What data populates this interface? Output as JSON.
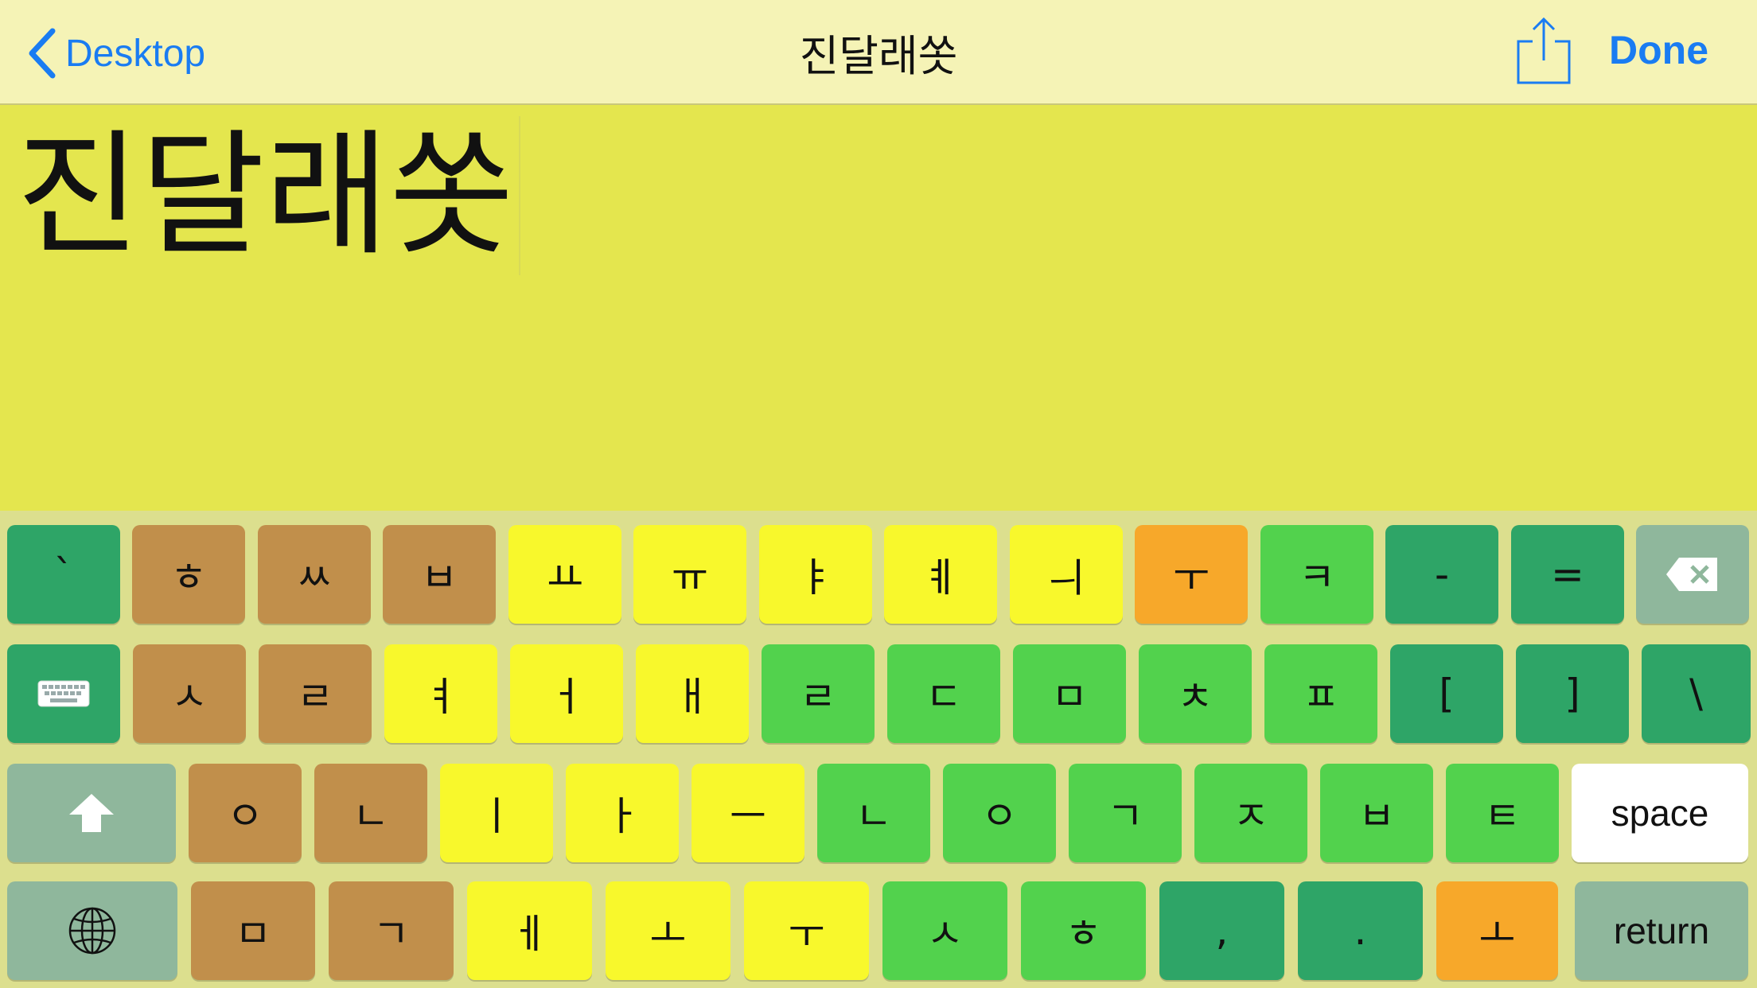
{
  "navbar": {
    "back_label": "Desktop",
    "title": "진달래쏫",
    "share_icon": "share-icon",
    "done_label": "Done"
  },
  "editor": {
    "text": "진달래쏫"
  },
  "colors": {
    "accent": "#1a7cf2",
    "background": "#e4e64e",
    "key_teal": "#2ea567",
    "key_brown": "#c18f4b",
    "key_yellow": "#f8f82c",
    "key_orange": "#f7a82a",
    "key_green": "#52d24d",
    "key_gray": "#8fb79c"
  },
  "keyboard": {
    "row1": [
      "`",
      "ㅎ",
      "ㅆ",
      "ㅂ",
      "ㅛ",
      "ㅠ",
      "ㅑ",
      "ㅖ",
      "ㅢ",
      "ㅜ",
      "ㅋ",
      "-",
      "=",
      "delete-icon"
    ],
    "row2": [
      "keyboard-icon",
      "ㅅ",
      "ㄹ",
      "ㅕ",
      "ㅓ",
      "ㅐ",
      "ㄹ",
      "ㄷ",
      "ㅁ",
      "ㅊ",
      "ㅍ",
      "[",
      "]",
      "\\"
    ],
    "row3": [
      "shift-icon",
      "ㅇ",
      "ㄴ",
      "ㅣ",
      "ㅏ",
      "ㅡ",
      "ㄴ",
      "ㅇ",
      "ㄱ",
      "ㅈ",
      "ㅂ",
      "ㅌ",
      "space"
    ],
    "row4": [
      "globe-icon",
      "ㅁ",
      "ㄱ",
      "ㅔ",
      "ㅗ",
      "ㅜ",
      "ㅅ",
      "ㅎ",
      ",",
      ".",
      "ㅗ",
      "return"
    ]
  }
}
